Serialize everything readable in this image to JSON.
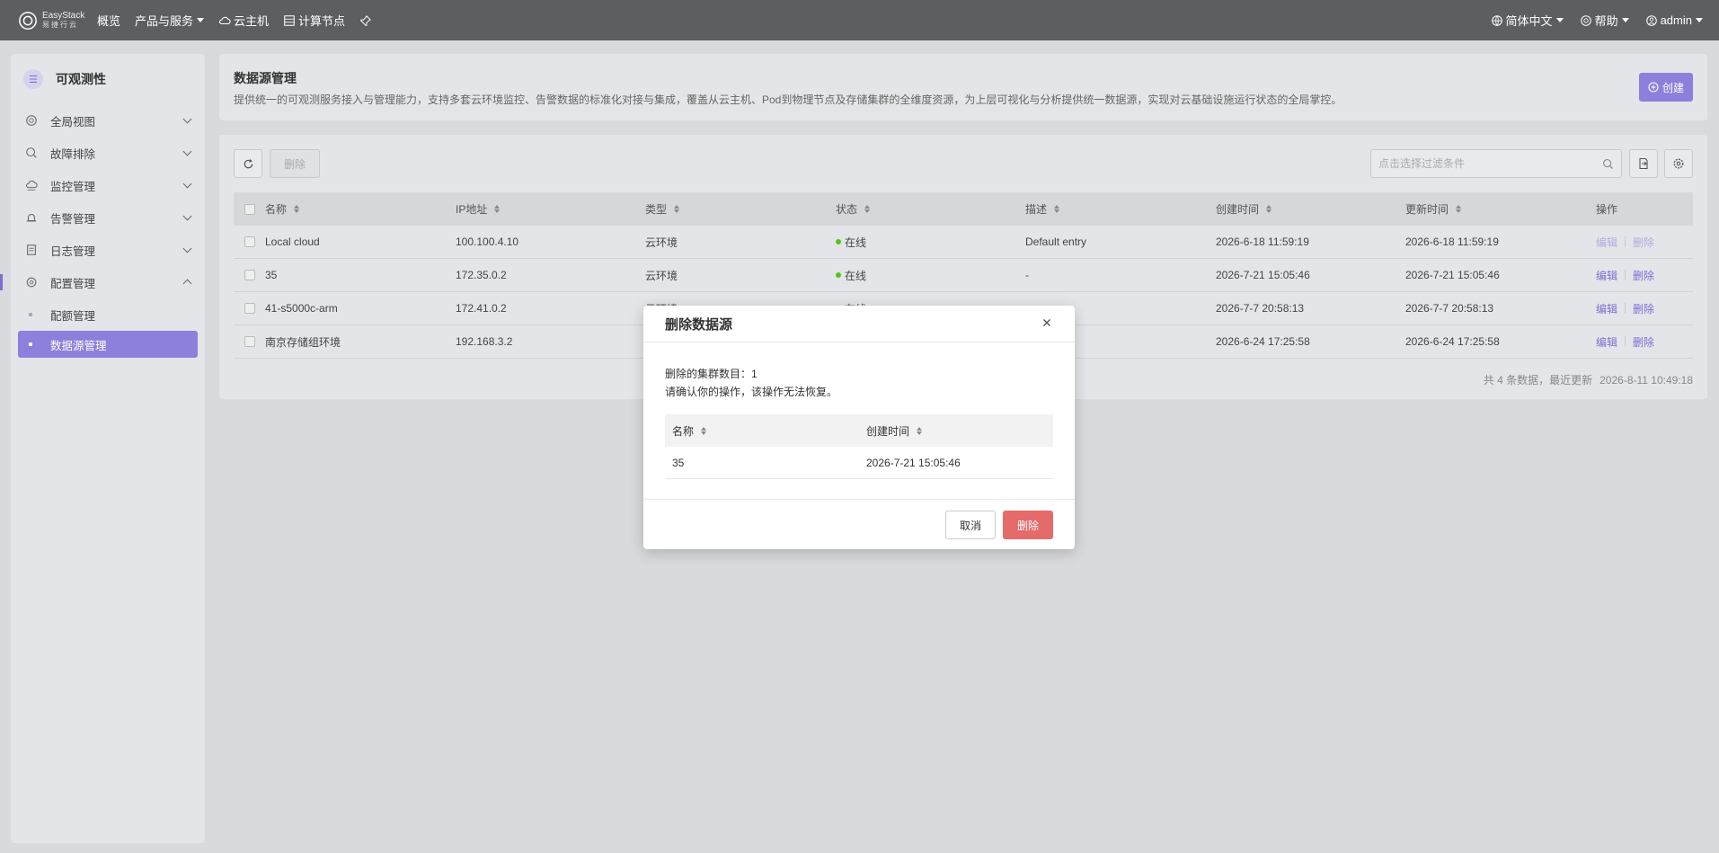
{
  "topbar": {
    "logo_en": "EasyStack",
    "logo_cn": "易捷行云",
    "nav": [
      {
        "label": "概览"
      },
      {
        "label": "产品与服务"
      },
      {
        "label": "云主机"
      },
      {
        "label": "计算节点"
      }
    ],
    "language": "简体中文",
    "help": "帮助",
    "user": "admin"
  },
  "sidebar": {
    "title": "可观测性",
    "items": [
      {
        "label": "全局视图"
      },
      {
        "label": "故障排除"
      },
      {
        "label": "监控管理"
      },
      {
        "label": "告警管理"
      },
      {
        "label": "日志管理"
      },
      {
        "label": "配置管理"
      }
    ],
    "sub_items": [
      {
        "label": "配额管理"
      },
      {
        "label": "数据源管理"
      }
    ]
  },
  "header": {
    "title": "数据源管理",
    "description": "提供统一的可观测服务接入与管理能力，支持多套云环境监控、告警数据的标准化对接与集成，覆盖从云主机、Pod到物理节点及存储集群的全维度资源，为上层可视化与分析提供统一数据源，实现对云基础设施运行状态的全局掌控。",
    "create_label": "创建"
  },
  "toolbar": {
    "delete_label": "删除",
    "search_placeholder": "点击选择过滤条件"
  },
  "table": {
    "columns": {
      "name": "名称",
      "ip": "IP地址",
      "type": "类型",
      "status": "状态",
      "desc": "描述",
      "created": "创建时间",
      "updated": "更新时间",
      "ops": "操作"
    },
    "rows": [
      {
        "name": "Local cloud",
        "ip": "100.100.4.10",
        "type": "云环境",
        "status": "在线",
        "desc": "Default entry",
        "created": "2026-6-18 11:59:19",
        "updated": "2026-6-18 11:59:19",
        "edit": "编辑",
        "delete": "删除"
      },
      {
        "name": "35",
        "ip": "172.35.0.2",
        "type": "云环境",
        "status": "在线",
        "desc": "-",
        "created": "2026-7-21 15:05:46",
        "updated": "2026-7-21 15:05:46",
        "edit": "编辑",
        "delete": "删除"
      },
      {
        "name": "41-s5000c-arm",
        "ip": "172.41.0.2",
        "type": "云环境",
        "status": "在线",
        "desc": "",
        "created": "2026-7-7 20:58:13",
        "updated": "2026-7-7 20:58:13",
        "edit": "编辑",
        "delete": "删除"
      },
      {
        "name": "南京存储组环境",
        "ip": "192.168.3.2",
        "type": "",
        "status": "",
        "desc": "",
        "created": "2026-6-24 17:25:58",
        "updated": "2026-6-24 17:25:58",
        "edit": "编辑",
        "delete": "删除"
      }
    ],
    "footer_total": "共 4 条数据，最近更新",
    "footer_time": "2026-8-11 10:49:18"
  },
  "modal": {
    "title": "删除数据源",
    "line1": "删除的集群数目：1",
    "line2": "请确认你的操作，该操作无法恢复。",
    "col_name": "名称",
    "col_created": "创建时间",
    "row": {
      "name": "35",
      "created": "2026-7-21 15:05:46"
    },
    "cancel_label": "取消",
    "confirm_label": "删除"
  },
  "colors": {
    "accent": "#8c80dc",
    "danger": "#e56b6b",
    "online": "#52c41a"
  }
}
